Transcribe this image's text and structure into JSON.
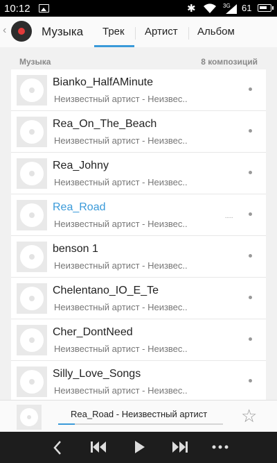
{
  "status_bar": {
    "time": "10:12",
    "network": "3G",
    "battery": "61"
  },
  "header": {
    "title": "Музыка",
    "tabs": [
      {
        "label": "Трек",
        "active": true
      },
      {
        "label": "Артист",
        "active": false
      },
      {
        "label": "Альбом",
        "active": false
      }
    ]
  },
  "section": {
    "title": "Музыка",
    "count": "8 композиций"
  },
  "tracks": [
    {
      "title": "Bianko_HalfAMinute",
      "subtitle": "Неизвестный артист - Неизвес.."
    },
    {
      "title": "Rea_On_The_Beach",
      "subtitle": "Неизвестный артист - Неизвес.."
    },
    {
      "title": "Rea_Johny",
      "subtitle": "Неизвестный артист - Неизвес.."
    },
    {
      "title": "Rea_Road",
      "subtitle": "Неизвестный артист - Неизвес..",
      "playing": true
    },
    {
      "title": "benson 1",
      "subtitle": "Неизвестный артист - Неизвес.."
    },
    {
      "title": "Chelentano_IO_E_Te",
      "subtitle": "Неизвестный артист - Неизвес.."
    },
    {
      "title": "Cher_DontNeed",
      "subtitle": "Неизвестный артист - Неизвес.."
    },
    {
      "title": "Silly_Love_Songs",
      "subtitle": "Неизвестный артист - Неизвес.."
    }
  ],
  "now_playing": {
    "title": "Rea_Road - Неизвестный артист",
    "progress": 0.1
  },
  "colors": {
    "accent": "#3a9ad9",
    "status_bar": "#000000",
    "controls_bar": "#1d1d1d"
  },
  "icons": {
    "back": "back-icon",
    "prev": "skip-previous-icon",
    "play": "play-icon",
    "next": "skip-next-icon",
    "more": "more-icon",
    "favorite": "star-icon"
  }
}
